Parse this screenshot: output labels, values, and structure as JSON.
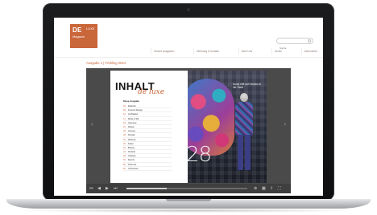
{
  "website": {
    "logo": {
      "main": "DE",
      "tail": "LUXE",
      "sub": "Magazin"
    },
    "search": {
      "placeholder": "Suche"
    },
    "nav": [
      "Unsere Ausgaben",
      "Werbung & Kontakt",
      "Über Uns",
      "Archiv",
      "Abonnieren"
    ],
    "page_title": "Ausgabe 1 | Frühling 2024"
  },
  "flipbook": {
    "left_page": {
      "heading": "INHALT",
      "script": "de luxe",
      "toc_heading": "Diese Ausgabe",
      "toc": [
        {
          "num": "04",
          "title": "Editorial"
        },
        {
          "num": "06",
          "title": "Kunst & Design"
        },
        {
          "num": "10",
          "title": "Architektur"
        },
        {
          "num": "14",
          "title": "Mode & Stil"
        },
        {
          "num": "18",
          "title": "Interview"
        },
        {
          "num": "22",
          "title": "Reisen"
        },
        {
          "num": "26",
          "title": "Genuss"
        },
        {
          "num": "28",
          "title": "Portrait"
        },
        {
          "num": "32",
          "title": "Wohnen"
        },
        {
          "num": "36",
          "title": "Kultur"
        },
        {
          "num": "40",
          "title": "Beauty"
        },
        {
          "num": "44",
          "title": "Technik"
        },
        {
          "num": "48",
          "title": "Lifestyle"
        },
        {
          "num": "52",
          "title": "Events"
        },
        {
          "num": "56",
          "title": "Kolumne"
        },
        {
          "num": "60",
          "title": "Impressum"
        }
      ]
    },
    "right_page": {
      "headline": "Kunst trifft auf Fashion in der Stadt",
      "page_number": "28"
    },
    "progress": 0.33
  }
}
